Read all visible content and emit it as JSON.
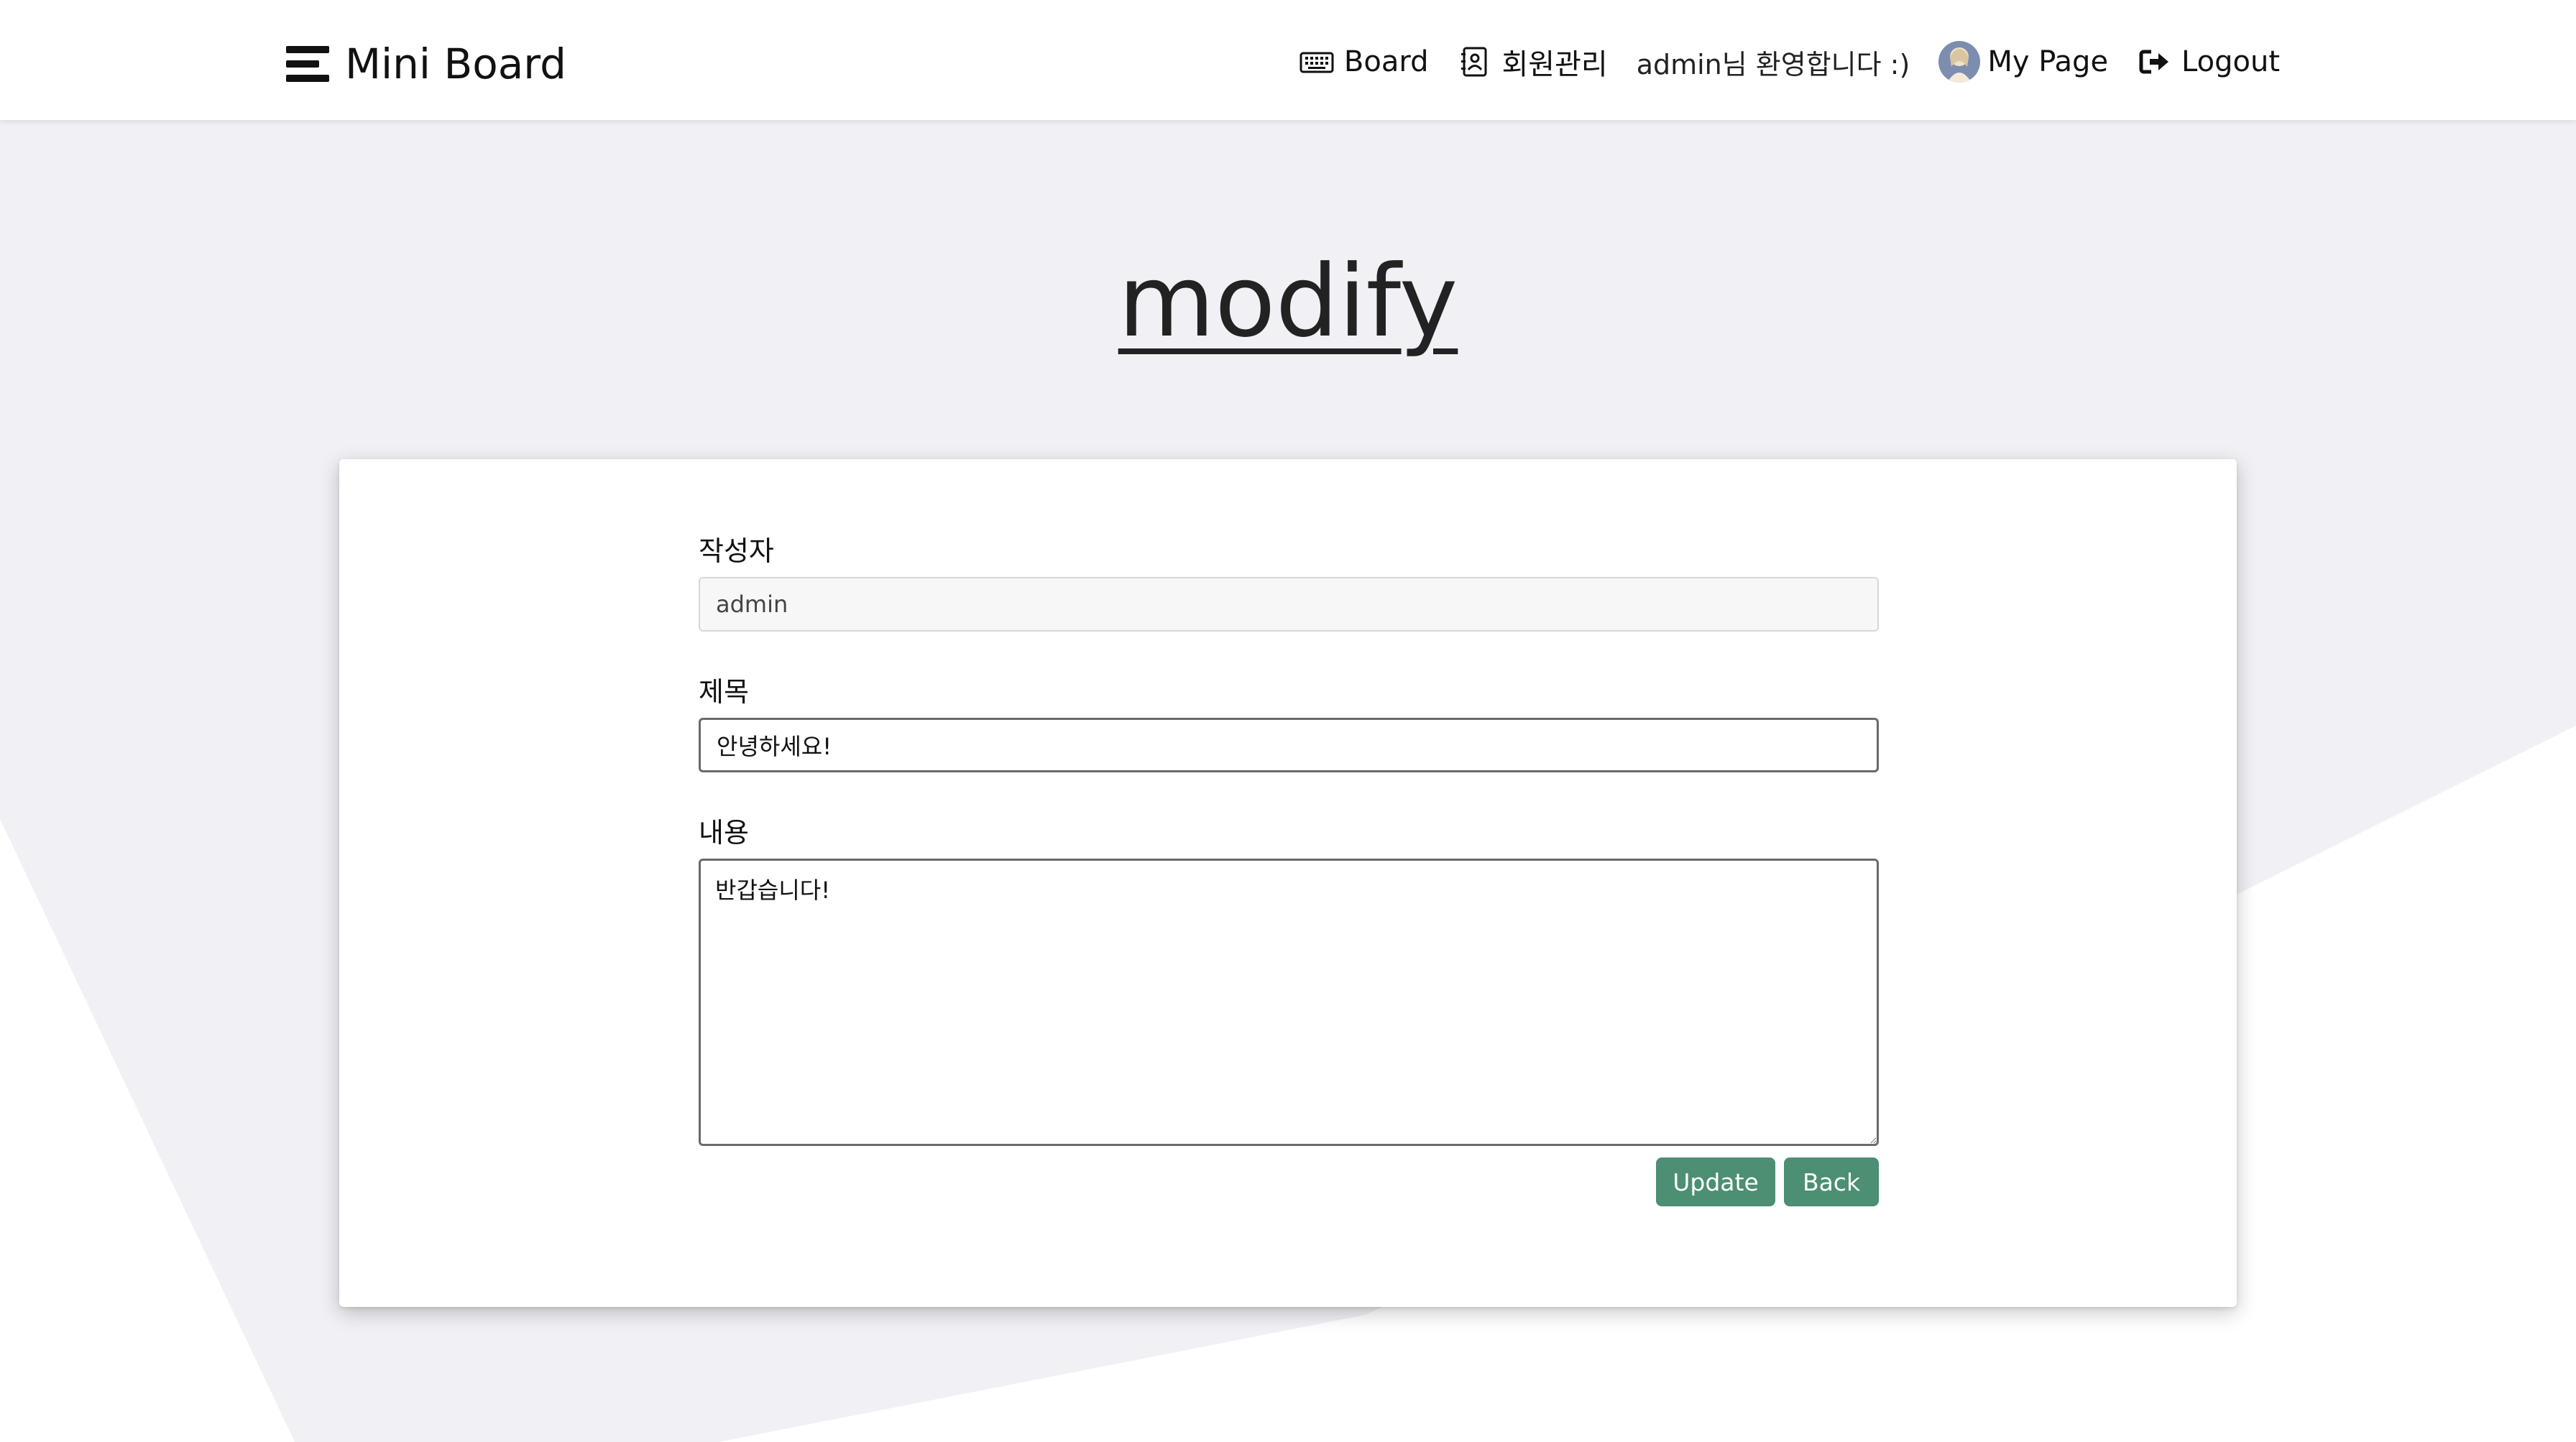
{
  "navbar": {
    "brand": "Mini Board",
    "brand_icon": "menu-lines-icon",
    "items": [
      {
        "label": "Board",
        "icon": "keyboard-icon"
      },
      {
        "label": "회원관리",
        "icon": "contact-book-icon"
      }
    ],
    "welcome": "admin님 환영합니다 :)",
    "mypage": {
      "label": "My Page",
      "icon": "avatar"
    },
    "logout": {
      "label": "Logout",
      "icon": "logout-icon"
    }
  },
  "page": {
    "title": "modify"
  },
  "form": {
    "author": {
      "label": "작성자",
      "value": "admin"
    },
    "title": {
      "label": "제목",
      "value": "안녕하세요!"
    },
    "content": {
      "label": "내용",
      "value": "반갑습니다!"
    }
  },
  "buttons": {
    "update": "Update",
    "back": "Back"
  },
  "colors": {
    "background": "#f1f0f5",
    "accent": "#4c8f72",
    "card": "#ffffff"
  }
}
